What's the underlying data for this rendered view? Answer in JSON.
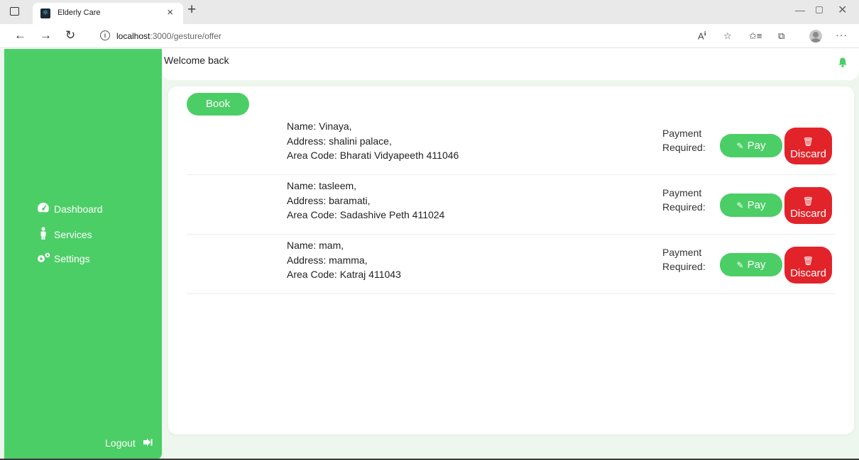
{
  "browser": {
    "tab_title": "Elderly Care",
    "url_host": "localhost",
    "url_path": ":3000/gesture/offer",
    "tab_close_glyph": "×",
    "new_tab_glyph": "+"
  },
  "sidebar": {
    "items": [
      {
        "label": "Dashboard",
        "icon": "dashboard-icon"
      },
      {
        "label": "Services",
        "icon": "person-icon"
      },
      {
        "label": "Settings",
        "icon": "cogs-icon"
      }
    ],
    "logout_label": "Logout"
  },
  "header": {
    "welcome": "Welcome back"
  },
  "main": {
    "book_label": "Book",
    "bookings": [
      {
        "name": "Name: Vinaya,",
        "address": "Address: shalini palace,",
        "area": "Area Code: Bharati Vidyapeeth 411046",
        "payment_line1": "Payment",
        "payment_line2": "Required:",
        "pay_label": "Pay",
        "discard_label": "Discard"
      },
      {
        "name": "Name: tasleem,",
        "address": "Address: baramati,",
        "area": "Area Code: Sadashive Peth 411024",
        "payment_line1": "Payment",
        "payment_line2": "Required:",
        "pay_label": "Pay",
        "discard_label": "Discard"
      },
      {
        "name": "Name: mam,",
        "address": "Address: mamma,",
        "area": "Area Code: Katraj 411043",
        "payment_line1": "Payment",
        "payment_line2": "Required:",
        "pay_label": "Pay",
        "discard_label": "Discard"
      }
    ]
  },
  "colors": {
    "accent": "#4cce66",
    "danger": "#e2232a",
    "background": "#eef7ee"
  }
}
